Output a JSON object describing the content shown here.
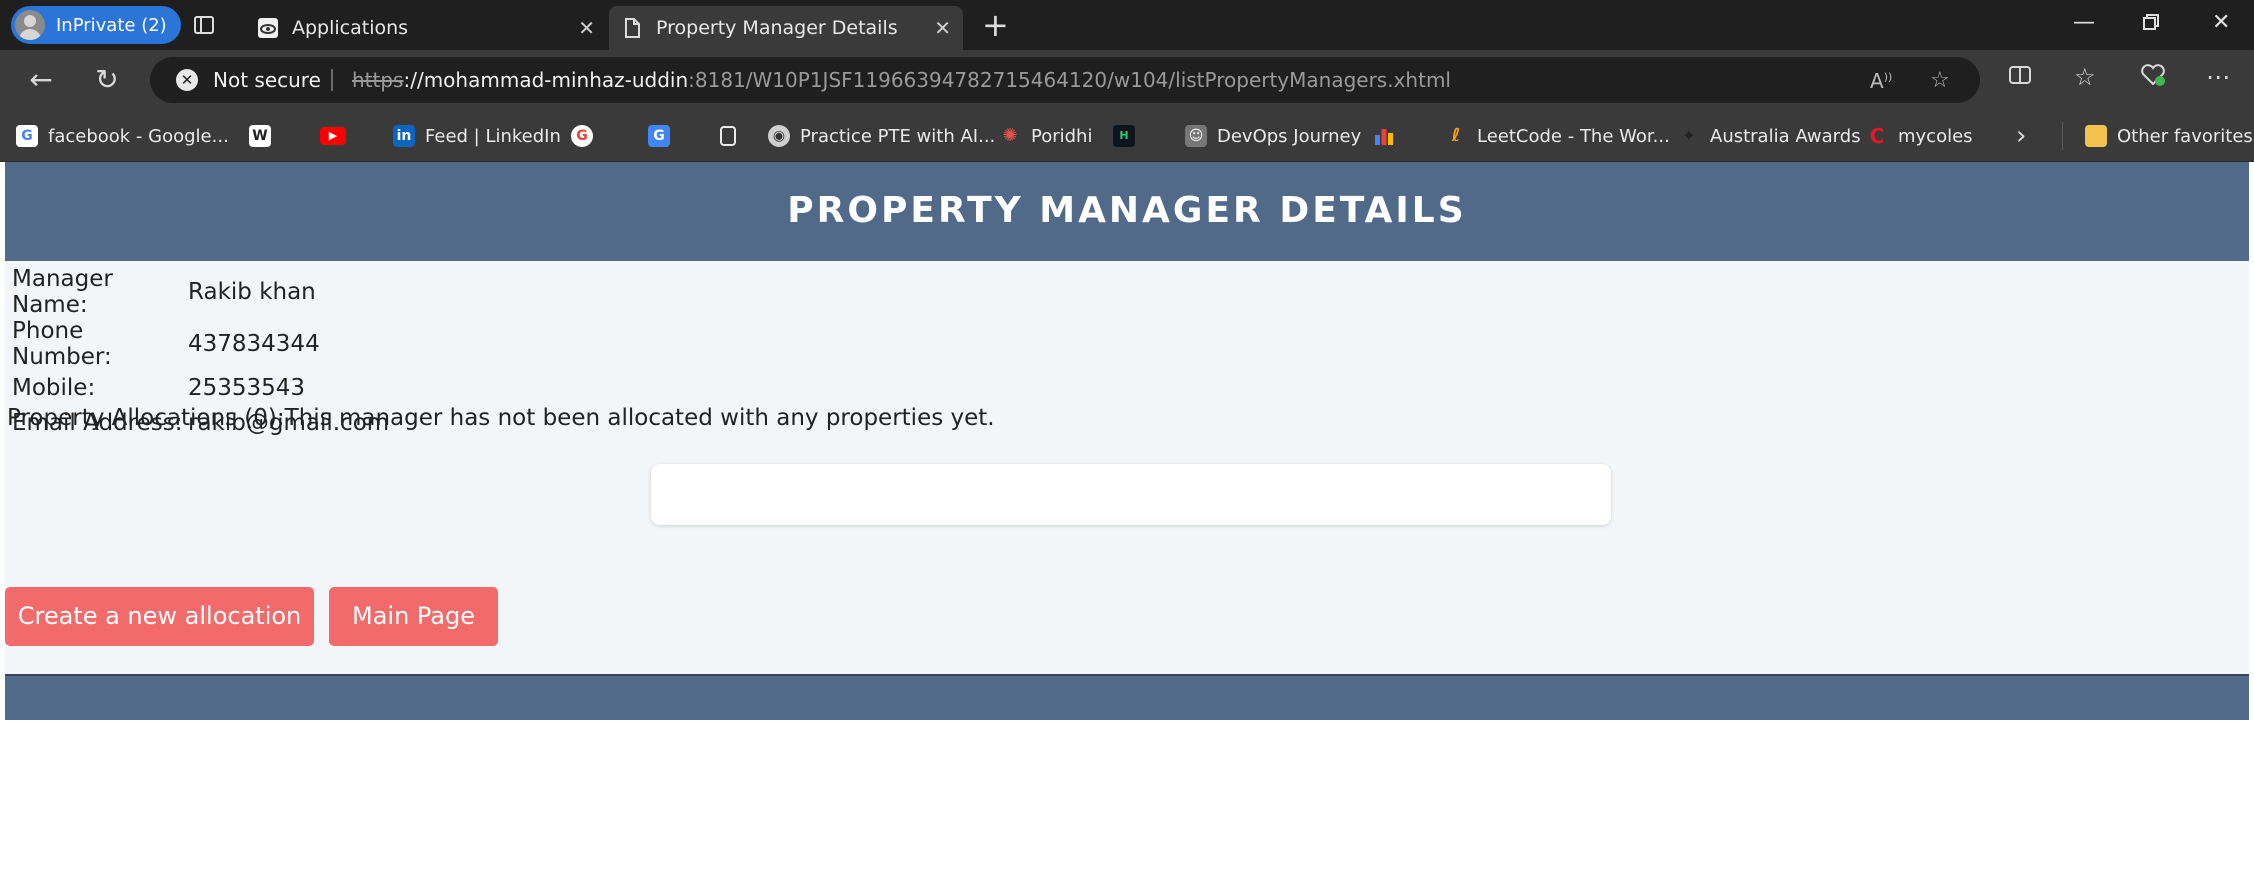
{
  "browser": {
    "inprivate_label": "InPrivate (2)",
    "tabs": [
      {
        "title": "Applications",
        "active": false
      },
      {
        "title": "Property Manager Details",
        "active": true
      }
    ],
    "security_label": "Not secure",
    "url": {
      "scheme": "https",
      "host": "://mohammad-minhaz-uddin",
      "rest": ":8181/W10P1JSF11966394782715464120/w104/listPropertyManagers.xhtml"
    },
    "bookmarks": [
      {
        "label": "facebook - Google..."
      },
      {
        "label": ""
      },
      {
        "label": ""
      },
      {
        "label": "Feed | LinkedIn"
      },
      {
        "label": ""
      },
      {
        "label": ""
      },
      {
        "label": ""
      },
      {
        "label": "Practice PTE with AI..."
      },
      {
        "label": "Poridhi"
      },
      {
        "label": ""
      },
      {
        "label": "DevOps Journey"
      },
      {
        "label": ""
      },
      {
        "label": "LeetCode - The Wor..."
      },
      {
        "label": "Australia Awards"
      },
      {
        "label": "mycoles"
      }
    ],
    "other_favorites": "Other favorites"
  },
  "page": {
    "title": "PROPERTY MANAGER DETAILS",
    "details": [
      {
        "label": "Manager Name:",
        "value": "Rakib khan"
      },
      {
        "label": "Phone Number:",
        "value": "437834344"
      },
      {
        "label": "Mobile:",
        "value": "25353543"
      },
      {
        "label": "Email Address:",
        "value": "rakib@gmail.com"
      }
    ],
    "allocations_text": "Property Allocations (0):This manager has not been allocated with any properties yet.",
    "create_button": "Create a new allocation",
    "main_button": "Main Page"
  },
  "colors": {
    "header": "#526a89",
    "button": "#f36a6a",
    "page_bg": "#f3f6f9"
  }
}
